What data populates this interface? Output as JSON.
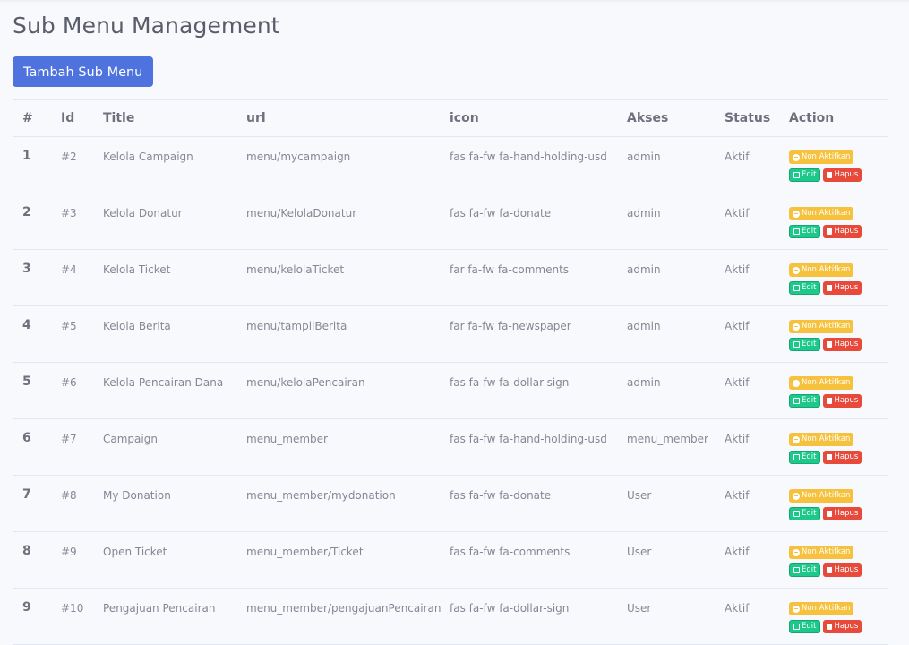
{
  "page": {
    "title": "Sub Menu Management",
    "add_button": "Tambah Sub Menu"
  },
  "table": {
    "headers": [
      "#",
      "Id",
      "Title",
      "url",
      "icon",
      "Akses",
      "Status",
      "Action"
    ],
    "action_labels": {
      "deactivate": "Non Aktifkan",
      "edit": "Edit",
      "delete": "Hapus"
    },
    "rows": [
      {
        "no": "1",
        "id": "#2",
        "title": "Kelola Campaign",
        "url": "menu/mycampaign",
        "icon": "fas fa-fw fa-hand-holding-usd",
        "akses": "admin",
        "status": "Aktif"
      },
      {
        "no": "2",
        "id": "#3",
        "title": "Kelola Donatur",
        "url": "menu/KelolaDonatur",
        "icon": "fas fa-fw fa-donate",
        "akses": "admin",
        "status": "Aktif"
      },
      {
        "no": "3",
        "id": "#4",
        "title": "Kelola Ticket",
        "url": "menu/kelolaTicket",
        "icon": "far fa-fw fa-comments",
        "akses": "admin",
        "status": "Aktif"
      },
      {
        "no": "4",
        "id": "#5",
        "title": "Kelola Berita",
        "url": "menu/tampilBerita",
        "icon": "far fa-fw fa-newspaper",
        "akses": "admin",
        "status": "Aktif"
      },
      {
        "no": "5",
        "id": "#6",
        "title": "Kelola Pencairan Dana",
        "url": "menu/kelolaPencairan",
        "icon": "fas fa-fw fa-dollar-sign",
        "akses": "admin",
        "status": "Aktif"
      },
      {
        "no": "6",
        "id": "#7",
        "title": "Campaign",
        "url": "menu_member",
        "icon": "fas fa-fw fa-hand-holding-usd",
        "akses": "menu_member",
        "status": "Aktif"
      },
      {
        "no": "7",
        "id": "#8",
        "title": "My Donation",
        "url": "menu_member/mydonation",
        "icon": "fas fa-fw fa-donate",
        "akses": "User",
        "status": "Aktif"
      },
      {
        "no": "8",
        "id": "#9",
        "title": "Open Ticket",
        "url": "menu_member/Ticket",
        "icon": "fas fa-fw fa-comments",
        "akses": "User",
        "status": "Aktif"
      },
      {
        "no": "9",
        "id": "#10",
        "title": "Pengajuan Pencairan",
        "url": "menu_member/pengajuanPencairan",
        "icon": "fas fa-fw fa-dollar-sign",
        "akses": "User",
        "status": "Aktif"
      }
    ]
  },
  "colors": {
    "primary": "#4e73df",
    "warning": "#f6c23e",
    "success": "#1cc88a",
    "danger": "#e74a3b"
  },
  "icons": {
    "deactivate": "minus-circle-icon",
    "edit": "edit-icon",
    "delete": "trash-icon"
  }
}
